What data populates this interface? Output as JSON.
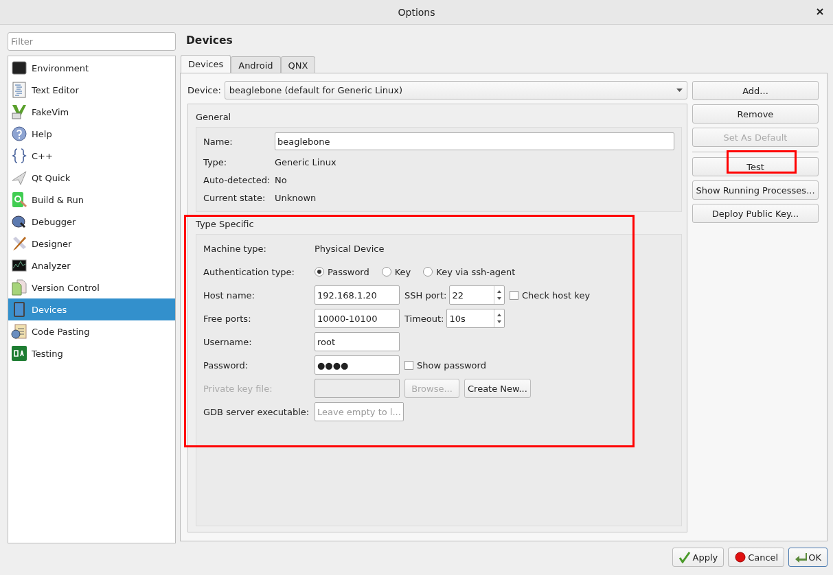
{
  "window": {
    "title": "Options"
  },
  "sidebar": {
    "filter_placeholder": "Filter",
    "items": [
      {
        "label": "Environment",
        "selected": false
      },
      {
        "label": "Text Editor",
        "selected": false
      },
      {
        "label": "FakeVim",
        "selected": false
      },
      {
        "label": "Help",
        "selected": false
      },
      {
        "label": "C++",
        "selected": false
      },
      {
        "label": "Qt Quick",
        "selected": false
      },
      {
        "label": "Build & Run",
        "selected": false
      },
      {
        "label": "Debugger",
        "selected": false
      },
      {
        "label": "Designer",
        "selected": false
      },
      {
        "label": "Analyzer",
        "selected": false
      },
      {
        "label": "Version Control",
        "selected": false
      },
      {
        "label": "Devices",
        "selected": true
      },
      {
        "label": "Code Pasting",
        "selected": false
      },
      {
        "label": "Testing",
        "selected": false
      }
    ]
  },
  "heading": "Devices",
  "tabs": [
    {
      "label": "Devices",
      "selected": true
    },
    {
      "label": "Android",
      "selected": false
    },
    {
      "label": "QNX",
      "selected": false
    }
  ],
  "device": {
    "label": "Device:",
    "value": "beaglebone (default for Generic Linux)"
  },
  "side_buttons": [
    {
      "label": "Add...",
      "disabled": false,
      "highlighted": false
    },
    {
      "label": "Remove",
      "disabled": false,
      "highlighted": false
    },
    {
      "label": "Set As Default",
      "disabled": true,
      "highlighted": false
    },
    {
      "label": "Test",
      "disabled": false,
      "highlighted": true
    },
    {
      "label": "Show Running Processes...",
      "disabled": false,
      "highlighted": false
    },
    {
      "label": "Deploy Public Key...",
      "disabled": false,
      "highlighted": false
    }
  ],
  "general": {
    "title": "General",
    "name": {
      "label": "Name:",
      "value": "beaglebone"
    },
    "info_rows": [
      {
        "label": "Type:",
        "value": "Generic Linux"
      },
      {
        "label": "Auto-detected:",
        "value": "No"
      },
      {
        "label": "Current state:",
        "value": "Unknown"
      }
    ]
  },
  "type_specific": {
    "title": "Type Specific",
    "highlighted": true,
    "machine_type": {
      "label": "Machine type:",
      "value": "Physical Device"
    },
    "auth": {
      "label": "Authentication type:",
      "options": [
        {
          "label": "Password",
          "selected": true
        },
        {
          "label": "Key",
          "selected": false
        },
        {
          "label": "Key via ssh-agent",
          "selected": false
        }
      ]
    },
    "host": {
      "label": "Host name:",
      "value": "192.168.1.20"
    },
    "ssh_port": {
      "label": "SSH port:",
      "value": "22"
    },
    "check_host_key": {
      "label": "Check host key",
      "checked": false
    },
    "free_ports": {
      "label": "Free ports:",
      "value": "10000-10100"
    },
    "timeout": {
      "label": "Timeout:",
      "value": "10s"
    },
    "username": {
      "label": "Username:",
      "value": "root"
    },
    "password": {
      "label": "Password:",
      "value": "●●●●"
    },
    "show_password": {
      "label": "Show password",
      "checked": false
    },
    "private_key": {
      "label": "Private key file:",
      "disabled": true,
      "browse": {
        "label": "Browse...",
        "disabled": true
      },
      "create_new": {
        "label": "Create New..."
      }
    },
    "gdb": {
      "label": "GDB server executable:",
      "placeholder": "Leave empty to l..."
    }
  },
  "buttons": [
    {
      "label": "Apply",
      "kind": "apply",
      "default": false
    },
    {
      "label": "Cancel",
      "kind": "cancel",
      "default": false
    },
    {
      "label": "OK",
      "kind": "ok",
      "default": true
    }
  ]
}
